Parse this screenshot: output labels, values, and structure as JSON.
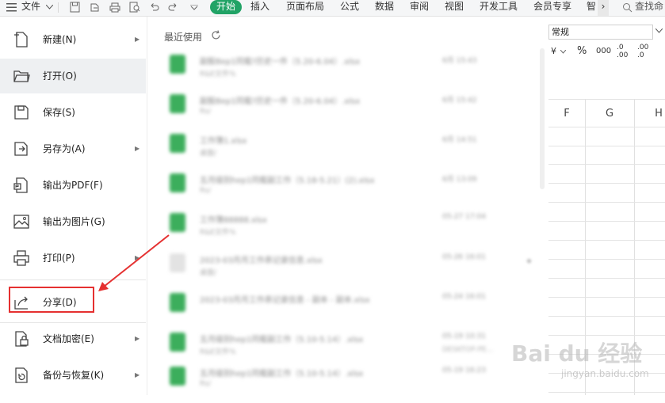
{
  "topbar": {
    "menu_icon": "hamburger-icon",
    "file_label": "文件",
    "tabs": [
      "开始",
      "插入",
      "页面布局",
      "公式",
      "数据",
      "审阅",
      "视图",
      "开发工具",
      "会员专享",
      "智"
    ],
    "more": "›",
    "search_label": "查找命"
  },
  "menu": {
    "items": [
      {
        "label": "新建(N)",
        "icon": "new-file-icon",
        "arrow": "▶"
      },
      {
        "label": "打开(O)",
        "icon": "folder-icon",
        "arrow": ""
      },
      {
        "label": "保存(S)",
        "icon": "save-icon",
        "arrow": ""
      },
      {
        "label": "另存为(A)",
        "icon": "save-as-icon",
        "arrow": "▶"
      },
      {
        "label": "输出为PDF(F)",
        "icon": "pdf-export-icon",
        "arrow": ""
      },
      {
        "label": "输出为图片(G)",
        "icon": "image-export-icon",
        "arrow": ""
      },
      {
        "label": "打印(P)",
        "icon": "print-icon",
        "arrow": "▶"
      },
      {
        "label": "分享(D)",
        "icon": "share-icon",
        "arrow": ""
      },
      {
        "label": "文档加密(E)",
        "icon": "encrypt-icon",
        "arrow": "▶"
      },
      {
        "label": "备份与恢复(K)",
        "icon": "backup-icon",
        "arrow": "▶"
      }
    ]
  },
  "recent": {
    "title": "最近使用",
    "files": [
      {
        "name": "副股Bep1同载?历史一件（5.20-6.04）.xlsx",
        "sub": "R&E文件%",
        "date": "6月 15:43",
        "device": "",
        "color": "green"
      },
      {
        "name": "副股Bep1同载?历史一件（5.20-6.04）.xlsx",
        "sub": "Rs/",
        "date": "6月 15:42",
        "device": "",
        "color": "green"
      },
      {
        "name": "工作簿1.xlsx",
        "sub": "桌面/",
        "date": "6月 14:51",
        "device": "",
        "color": "green"
      },
      {
        "name": "五月级别hep1同载副工作（5.18-5.21）(2).xlsx",
        "sub": "Rs/",
        "date": "6月 13:09",
        "device": "",
        "color": "green"
      },
      {
        "name": "工作簿88888.xlsx",
        "sub": "R&E文件%",
        "date": "05-27 17:04",
        "device": "",
        "color": "green"
      },
      {
        "name": "2023-03月月工作表记录信息.xlsx",
        "sub": "桌面/",
        "date": "05-26 16:01",
        "device": "",
        "color": "grey"
      },
      {
        "name": "2023-03月月工作表记录信息 - 副本 - 副本.xlsx",
        "sub": "",
        "date": "05-24 16:01",
        "device": "",
        "color": "green"
      },
      {
        "name": "五月级别hep1同载副工作（5.10-5.14）.xlsx",
        "sub": "R&E文件%",
        "date": "05-19 10:31",
        "device": "DESKTOP-PE...",
        "color": "green"
      },
      {
        "name": "五月级别hep1同载副工作（5.10-5.14）.xlsx",
        "sub": "Rs/",
        "date": "05-19 16:23",
        "device": "",
        "color": "green"
      }
    ]
  },
  "ribbon": {
    "number_format": "常规",
    "currency": "¥",
    "percent": "%",
    "thousands": "000",
    "inc_decimal": ".0\n.00",
    "dec_decimal": ".00\n.0"
  },
  "sheet": {
    "columns": [
      "F",
      "G",
      "H"
    ]
  },
  "watermark": {
    "brand": "Bai du 经验",
    "url": "jingyan.baidu.com"
  },
  "colors": {
    "accent_green": "#21a366",
    "highlight_red": "#e53030"
  }
}
